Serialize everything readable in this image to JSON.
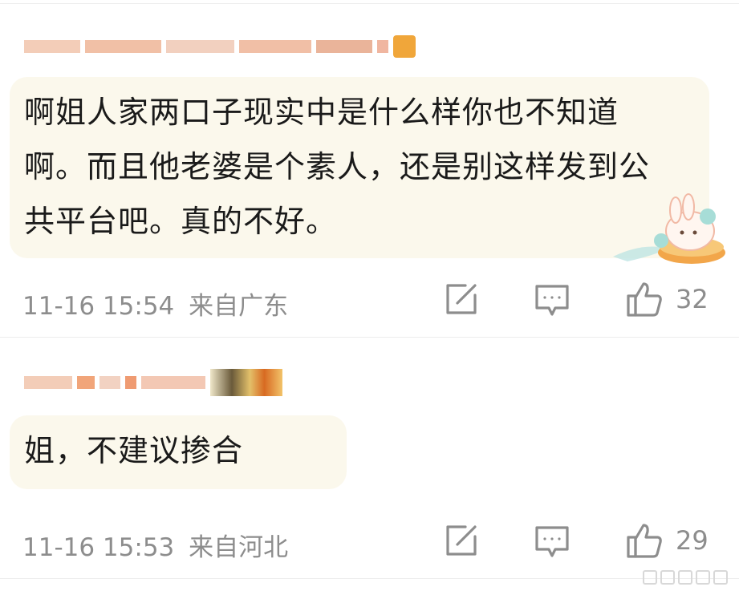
{
  "comments": [
    {
      "body": "啊姐人家两口子现实中是什么样你也不知道啊。而且他老婆是个素人，还是别这样发到公共平台吧。真的不好。",
      "time": "11-16 15:54",
      "location": "来自广东",
      "like_count": "32",
      "share_icon": "share-icon",
      "reply_icon": "comment-icon",
      "like_icon": "thumbs-up-icon"
    },
    {
      "body": "姐，不建议掺合",
      "time": "11-16 15:53",
      "location": "来自河北",
      "like_count": "29",
      "share_icon": "share-icon",
      "reply_icon": "comment-icon",
      "like_icon": "thumbs-up-icon"
    }
  ],
  "colors": {
    "bubble_bg": "#fbf8ec",
    "meta_text": "#8d8d8d",
    "body_text": "#1a1a1a"
  }
}
